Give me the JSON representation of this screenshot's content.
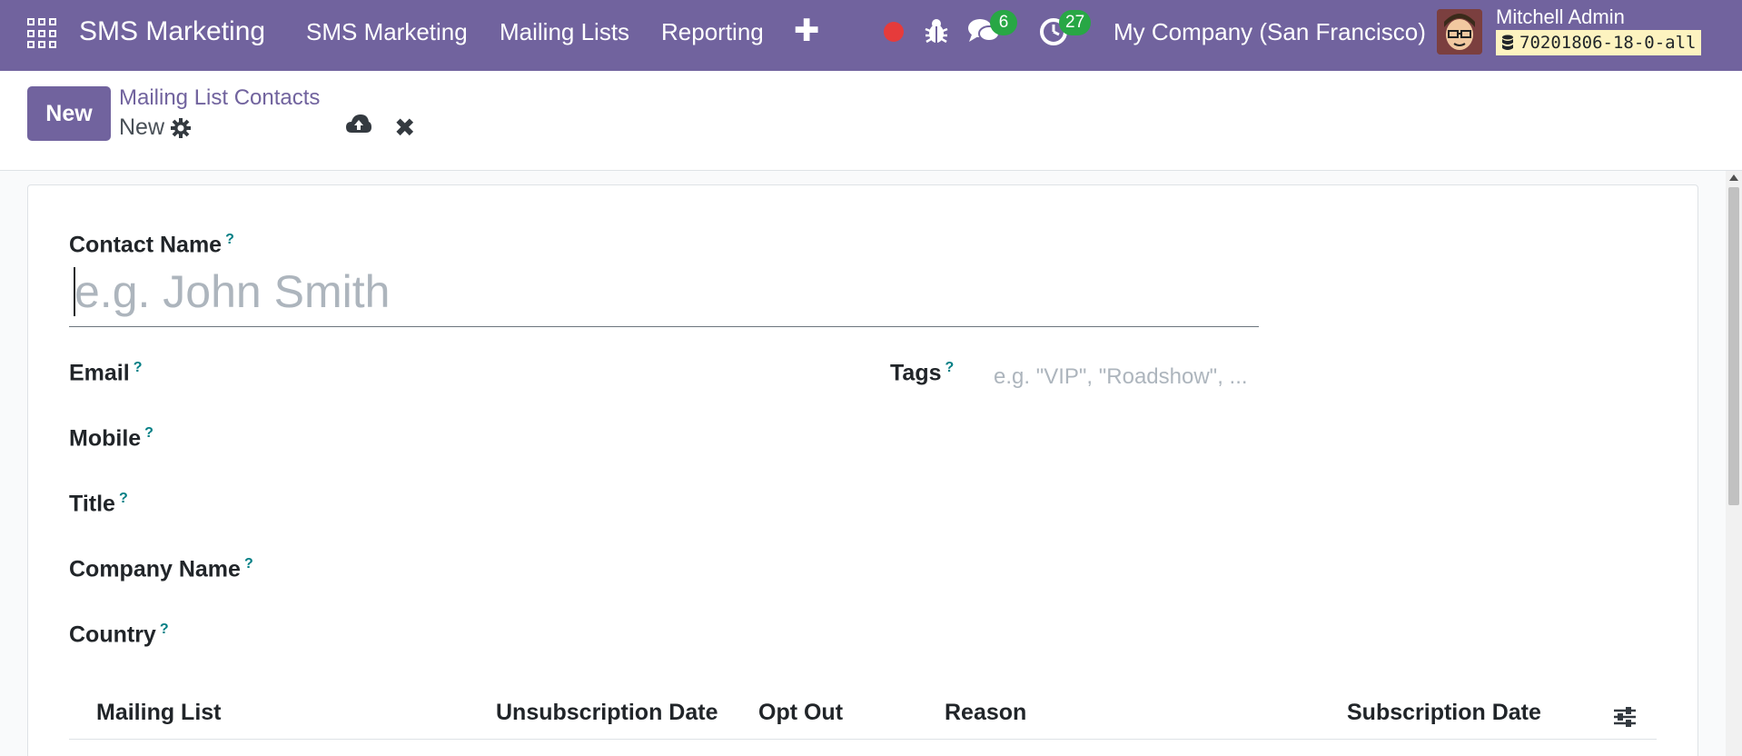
{
  "navbar": {
    "brand": "SMS Marketing",
    "menu": [
      "SMS Marketing",
      "Mailing Lists",
      "Reporting"
    ],
    "messages_count": "6",
    "activities_count": "27",
    "company": "My Company (San Francisco)",
    "user_name": "Mitchell Admin",
    "database": "70201806-18-0-all",
    "colors": {
      "navbar": "#71639e",
      "badge": "#28a745",
      "record": "#e63b3b"
    }
  },
  "control_panel": {
    "new_label": "New",
    "breadcrumb_parent": "Mailing List Contacts",
    "breadcrumb_current": "New"
  },
  "form": {
    "contact_name_label": "Contact Name",
    "contact_name_placeholder": "e.g. John Smith",
    "email_label": "Email",
    "tags_label": "Tags",
    "tags_placeholder": "e.g. \"VIP\", \"Roadshow\", ...",
    "mobile_label": "Mobile",
    "title_label": "Title",
    "company_name_label": "Company Name",
    "country_label": "Country",
    "help_mark": "?"
  },
  "subscriptions_table": {
    "columns": [
      "Mailing List",
      "Unsubscription Date",
      "Opt Out",
      "Reason",
      "Subscription Date"
    ]
  }
}
